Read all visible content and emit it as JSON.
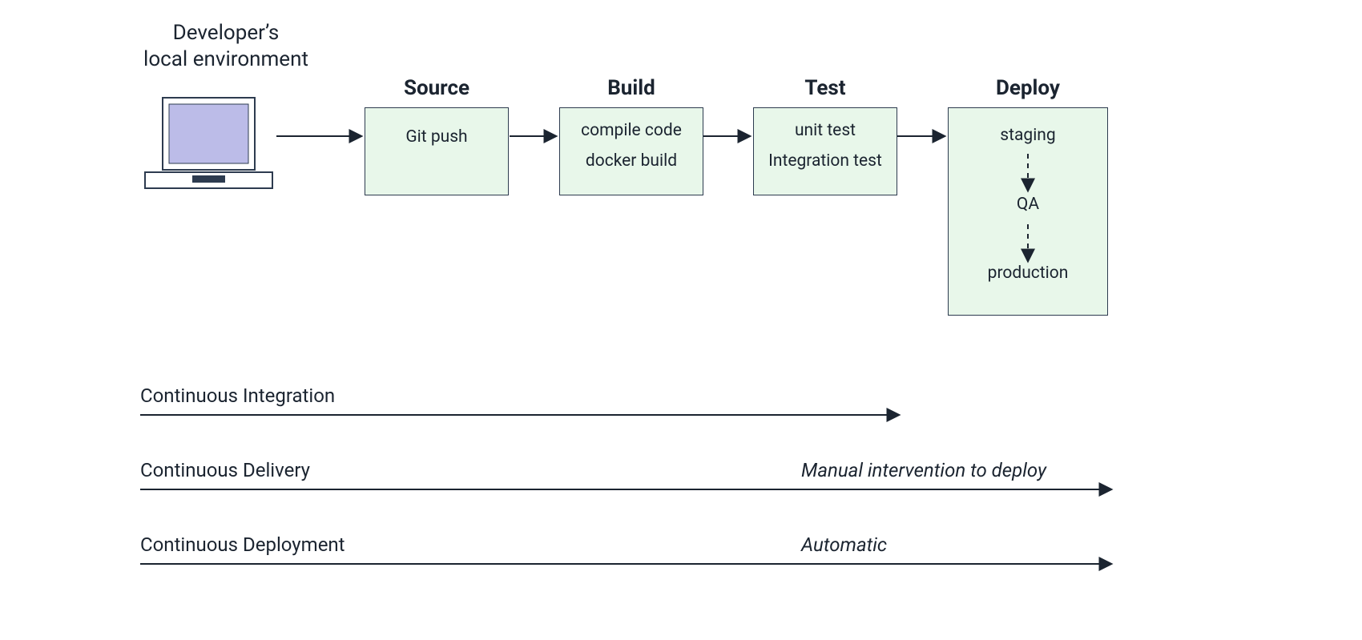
{
  "developer": {
    "title_line1": "Developer’s",
    "title_line2": "local environment"
  },
  "stages": {
    "source": {
      "title": "Source",
      "items": [
        "Git push"
      ]
    },
    "build": {
      "title": "Build",
      "items": [
        "compile code",
        "docker build"
      ]
    },
    "test": {
      "title": "Test",
      "items": [
        "unit test",
        "Integration test"
      ]
    },
    "deploy": {
      "title": "Deploy",
      "items": [
        "staging",
        "QA",
        "production"
      ]
    }
  },
  "legends": {
    "ci": {
      "label": "Continuous Integration",
      "note": ""
    },
    "cd_del": {
      "label": "Continuous Delivery",
      "note": "Manual intervention to deploy"
    },
    "cd_dep": {
      "label": "Continuous Deployment",
      "note": "Automatic"
    }
  },
  "colors": {
    "line": "#1b2430",
    "box_fill": "#e8f7ea",
    "box_border": "#2d3b4f",
    "laptop_screen": "#bcbce8"
  },
  "chart_data": {
    "type": "table",
    "pipeline": [
      {
        "stage": "Developer’s local environment",
        "actions": []
      },
      {
        "stage": "Source",
        "actions": [
          "Git push"
        ]
      },
      {
        "stage": "Build",
        "actions": [
          "compile code",
          "docker build"
        ]
      },
      {
        "stage": "Test",
        "actions": [
          "unit test",
          "Integration test"
        ]
      },
      {
        "stage": "Deploy",
        "actions": [
          "staging",
          "QA",
          "production"
        ],
        "flow": "staging → QA → production"
      }
    ],
    "scopes": [
      {
        "name": "Continuous Integration",
        "covers_through": "Test",
        "note": ""
      },
      {
        "name": "Continuous Delivery",
        "covers_through": "Deploy",
        "note": "Manual intervention to deploy"
      },
      {
        "name": "Continuous Deployment",
        "covers_through": "Deploy",
        "note": "Automatic"
      }
    ]
  }
}
